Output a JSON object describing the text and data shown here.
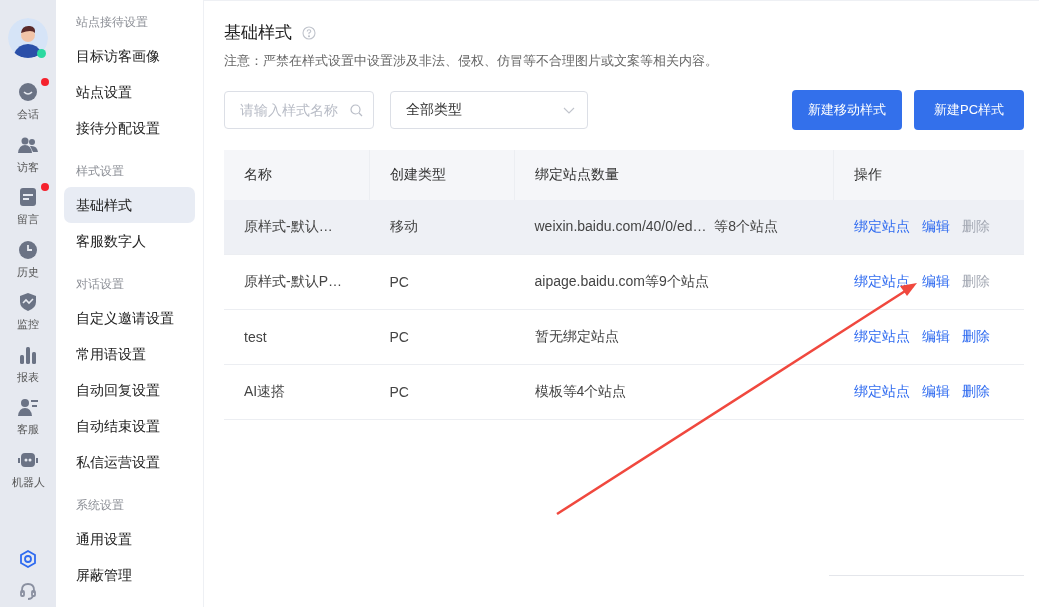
{
  "rail": {
    "online": true,
    "items": [
      {
        "label": "会话",
        "badge": true
      },
      {
        "label": "访客",
        "badge": false
      },
      {
        "label": "留言",
        "badge": true
      },
      {
        "label": "历史",
        "badge": false
      },
      {
        "label": "监控",
        "badge": false
      },
      {
        "label": "报表",
        "badge": false
      },
      {
        "label": "客服",
        "badge": false
      },
      {
        "label": "机器人",
        "badge": false
      }
    ],
    "bottom": [
      {
        "selected": true
      },
      {
        "selected": false
      }
    ]
  },
  "sidebar": {
    "groups": [
      {
        "title": "站点接待设置",
        "items": [
          {
            "label": "目标访客画像",
            "selected": false
          },
          {
            "label": "站点设置",
            "selected": false
          },
          {
            "label": "接待分配设置",
            "selected": false
          }
        ]
      },
      {
        "title": "样式设置",
        "items": [
          {
            "label": "基础样式",
            "selected": true
          },
          {
            "label": "客服数字人",
            "selected": false
          }
        ]
      },
      {
        "title": "对话设置",
        "items": [
          {
            "label": "自定义邀请设置",
            "selected": false
          },
          {
            "label": "常用语设置",
            "selected": false
          },
          {
            "label": "自动回复设置",
            "selected": false
          },
          {
            "label": "自动结束设置",
            "selected": false
          },
          {
            "label": "私信运营设置",
            "selected": false
          }
        ]
      },
      {
        "title": "系统设置",
        "items": [
          {
            "label": "通用设置",
            "selected": false
          },
          {
            "label": "屏蔽管理",
            "selected": false
          }
        ]
      }
    ]
  },
  "page": {
    "title": "基础样式",
    "notice": "注意：严禁在样式设置中设置涉及非法、侵权、仿冒等不合理图片或文案等相关内容。"
  },
  "search": {
    "placeholder": "请输入样式名称"
  },
  "type_select": {
    "value": "全部类型"
  },
  "buttons": [
    "新建移动样式",
    "新建PC样式"
  ],
  "table": {
    "columns": [
      "名称",
      "创建类型",
      "绑定站点数量",
      "操作"
    ],
    "rows": [
      {
        "name": "原样式-默认…",
        "type": "移动",
        "sites": "weixin.baidu.com/40/0/ed…  等8个站点",
        "highlighted": true,
        "actions": [
          {
            "label": "绑定站点",
            "disabled": false
          },
          {
            "label": "编辑",
            "disabled": false
          },
          {
            "label": "删除",
            "disabled": true
          }
        ]
      },
      {
        "name": "原样式-默认P…",
        "type": "PC",
        "sites": "aipage.baidu.com等9个站点",
        "highlighted": false,
        "actions": [
          {
            "label": "绑定站点",
            "disabled": false
          },
          {
            "label": "编辑",
            "disabled": false
          },
          {
            "label": "删除",
            "disabled": true
          }
        ]
      },
      {
        "name": "test",
        "type": "PC",
        "sites": "暂无绑定站点",
        "highlighted": false,
        "actions": [
          {
            "label": "绑定站点",
            "disabled": false
          },
          {
            "label": "编辑",
            "disabled": false
          },
          {
            "label": "删除",
            "disabled": false
          }
        ]
      },
      {
        "name": "AI速搭",
        "type": "PC",
        "sites": "模板等4个站点",
        "highlighted": false,
        "actions": [
          {
            "label": "绑定站点",
            "disabled": false
          },
          {
            "label": "编辑",
            "disabled": false
          },
          {
            "label": "删除",
            "disabled": false
          }
        ]
      }
    ]
  }
}
